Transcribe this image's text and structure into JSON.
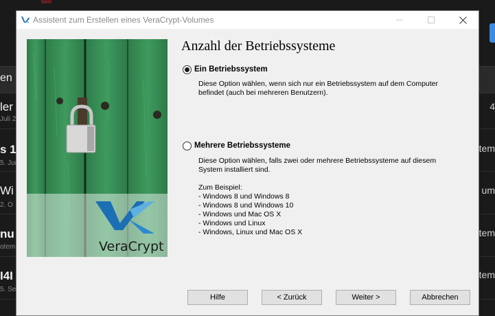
{
  "background_app": {
    "top_red_text": "best",
    "header_label": "en",
    "rows": [
      {
        "left_big": "ler V",
        "left_small": "Juli 2",
        "right": "4"
      },
      {
        "left_big": "s 1",
        "left_small": "5. Jun",
        "right": "otem"
      },
      {
        "left_big": "Wi",
        "left_small": "2. O",
        "right": "um"
      },
      {
        "left_big": "nu",
        "left_small": "otem",
        "right": "otem"
      },
      {
        "left_big": "I4I",
        "left_small": "5. Sep",
        "right": "otem"
      }
    ]
  },
  "window": {
    "title": "Assistent zum Erstellen eines VeraCrypt-Volumes"
  },
  "side_image": {
    "brand": "VeraCrypt"
  },
  "page": {
    "heading": "Anzahl der Betriebssysteme",
    "options": [
      {
        "label": "Ein Betriebssystem",
        "selected": true,
        "description": [
          "Diese Option wählen, wenn sich nur ein Betriebssystem auf dem Computer",
          "befindet (auch bei mehreren Benutzern)."
        ]
      },
      {
        "label": "Mehrere Betriebssysteme",
        "selected": false,
        "description": [
          "Diese Option wählen, falls zwei oder mehrere Betriebssysteme auf diesem",
          "System installiert sind."
        ],
        "examples_title": "Zum Beispiel:",
        "examples": [
          "- Windows 8 und Windows 8",
          "- Windows 8 und Windows 10",
          "- Windows und Mac OS X",
          "- Windows und Linux",
          "- Windows, Linux und Mac OS X"
        ]
      }
    ]
  },
  "buttons": {
    "help": "Hilfe",
    "back": "< Zurück",
    "next": "Weiter >",
    "cancel": "Abbrechen"
  },
  "colors": {
    "dialog_bg": "#f0f0f0",
    "button_bg": "#e1e1e1",
    "door_green": "#3a8f58",
    "brand_blue": "#1c6fb5"
  }
}
